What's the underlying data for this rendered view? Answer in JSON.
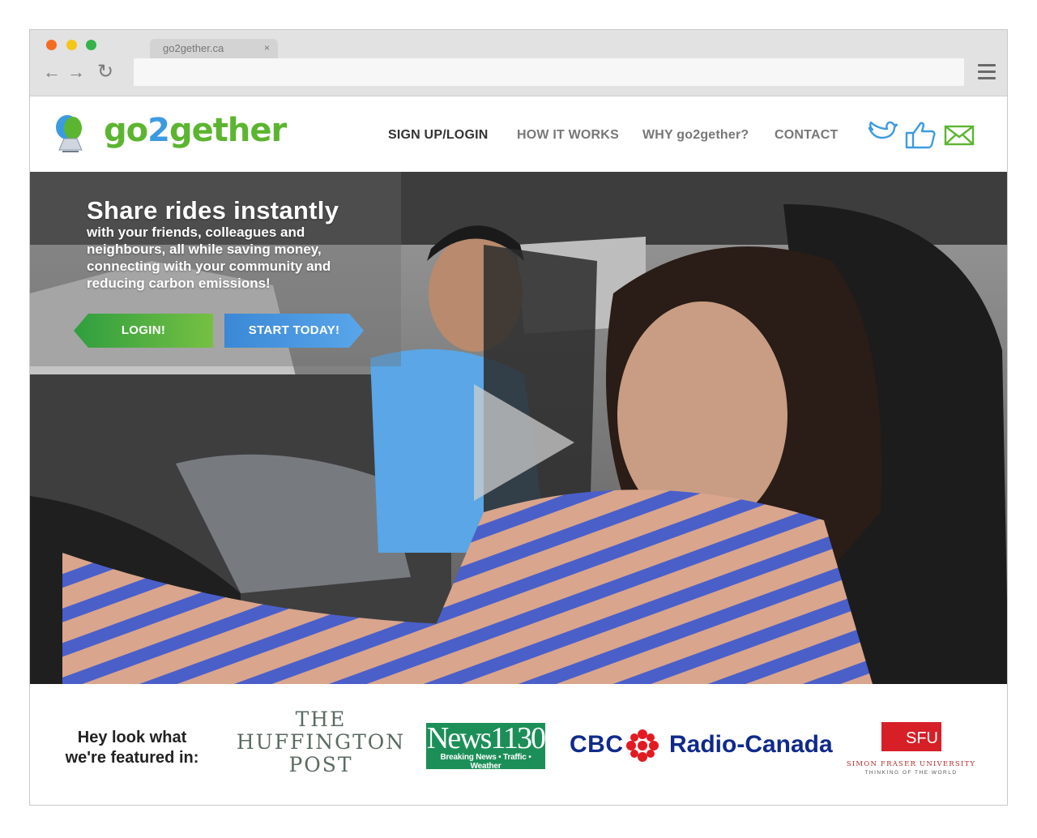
{
  "browser": {
    "tab_title": "go2gether.ca",
    "tab_close": "×",
    "back_glyph": "←",
    "forward_glyph": "→",
    "reload_glyph": "↻",
    "url": ""
  },
  "site": {
    "logo_part1": "go",
    "logo_part2": "2",
    "logo_part3": "gether",
    "nav": [
      {
        "label": "SIGN UP/LOGIN",
        "color": "#333333"
      },
      {
        "label": "HOW IT WORKS",
        "color": "#777777"
      },
      {
        "label": "WHY go2gether?",
        "color": "#777777"
      },
      {
        "label": "CONTACT",
        "color": "#777777"
      }
    ],
    "social_icons": [
      "twitter-bird-icon",
      "facebook-like-icon",
      "email-envelope-icon"
    ]
  },
  "hero": {
    "title": "Share rides instantly",
    "subtitle": "with your friends, colleagues and neighbours, all while saving money, connecting with your community and reducing carbon emissions!",
    "login_label": "LOGIN!",
    "start_label": "START TODAY!",
    "media": "video-player showing two people sharing a car ride"
  },
  "featured": {
    "label_line1": "Hey look what",
    "label_line2": "we're featured in:",
    "huffington": [
      "THE",
      "HUFFINGTON",
      "POST"
    ],
    "news_main": "News1130",
    "news_tag": "Breaking News • Traffic • Weather",
    "cbc": "CBC",
    "radio_canada": "Radio-Canada",
    "sfu_badge": "SFU",
    "sfu_name": "SIMON FRASER UNIVERSITY",
    "sfu_tagline": "THINKING OF THE WORLD"
  },
  "colors": {
    "brand_green": "#5cb530",
    "brand_blue": "#3c9be0",
    "login_green": "#2f9e3f",
    "start_blue": "#3b88d6"
  }
}
